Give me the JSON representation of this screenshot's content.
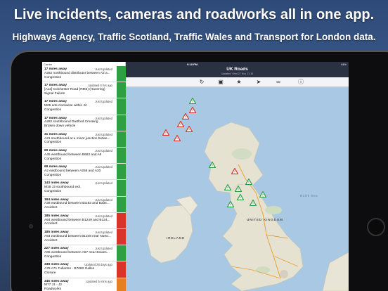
{
  "promo": {
    "headline": "Live incidents, cameras and roadworks all in one app.",
    "subline": "Highways Agency, Traffic Scotland, Traffic Wales and Transport for London data."
  },
  "status_bar": {
    "carrier": "Carrier",
    "time": "9:18 PM",
    "battery": "44%"
  },
  "map_header": {
    "title": "UK Roads",
    "subtitle": "Updated: Wed 27 Nov 21:16"
  },
  "toolbar": {
    "icons": [
      "refresh-icon",
      "camera-icon",
      "star-icon",
      "location-arrow-icon",
      "link-icon",
      "info-icon"
    ]
  },
  "map_labels": {
    "united_kingdom": "UNITED KINGDOM",
    "ireland": "IRELAND",
    "north_sea": "North Sea"
  },
  "incidents": [
    {
      "distance": "17 miles away",
      "updated": "Just Updated",
      "road": "A282 northbound distributor between A2 a...",
      "type": "Congestion",
      "severity": "#2ea043"
    },
    {
      "distance": "17 miles away",
      "updated": "Updated 6 hrs ago",
      "road": "[A12] Colchester Road (RM3) (Havering)",
      "type": "Signal Failure",
      "severity": "#2ea043"
    },
    {
      "distance": "17 miles away",
      "updated": "Just Updated",
      "road": "M25 anti-clockwise within J2",
      "type": "Congestion",
      "severity": "#2ea043"
    },
    {
      "distance": "17 miles away",
      "updated": "Just Updated",
      "road": "A282 southbound Dartford Crossing",
      "type": "Broken down vehicle",
      "severity": "#2ea043"
    },
    {
      "distance": "31 miles away",
      "updated": "Just Updated",
      "road": "A21 southbound at a minor junction betwe...",
      "type": "Congestion",
      "severity": "#2ea043"
    },
    {
      "distance": "60 miles away",
      "updated": "Just Updated",
      "road": "A45 westbound between B663 and A6",
      "type": "Congestion",
      "severity": "#2ea043"
    },
    {
      "distance": "69 miles away",
      "updated": "Just Updated",
      "road": "A2 eastbound between A258 and A20",
      "type": "Congestion",
      "severity": "#2ea043"
    },
    {
      "distance": "143 miles away",
      "updated": "Just Updated",
      "road": "M18 J3 southbound exit",
      "type": "Congestion",
      "severity": "#2ea043"
    },
    {
      "distance": "164 miles away",
      "updated": "Just Updated",
      "road": "A38 eastbound between B3193 and B334...",
      "type": "Accident",
      "severity": "#2ea043"
    },
    {
      "distance": "185 miles away",
      "updated": "Just Updated",
      "road": "A64 westbound between B1249 and B124...",
      "type": "Accident",
      "severity": "#d9342b"
    },
    {
      "distance": "185 miles away",
      "updated": "Just Updated",
      "road": "A64 eastbound between B1248 near Norto...",
      "type": "Accident",
      "severity": "#d9342b"
    },
    {
      "distance": "227 miles away",
      "updated": "Just Updated",
      "road": "A66 westbound between A67 near Bowes...",
      "type": "Congestion",
      "severity": "#2ea043"
    },
    {
      "distance": "338 miles away",
      "updated": "Updated 28 days ago",
      "road": "A78 A71 Fullarton - B7080 Galles",
      "type": "Closure",
      "severity": "#d9342b"
    },
    {
      "distance": "345 miles away",
      "updated": "Updated 5 mins ago",
      "road": "M77 J1 - J2",
      "type": "Roadworks",
      "severity": "#e67e22"
    }
  ]
}
